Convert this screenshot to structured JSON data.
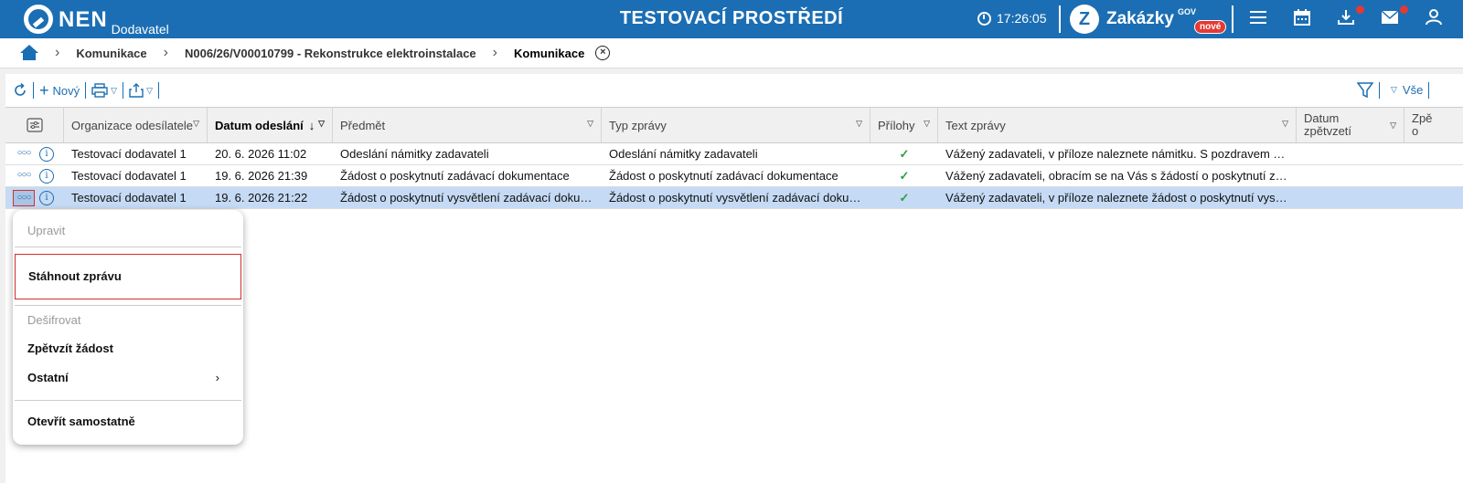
{
  "header": {
    "logo_text": "NEN",
    "logo_sub": "Dodavatel",
    "environment_title": "TESTOVACÍ PROSTŘEDÍ",
    "time": "17:26:05",
    "zakazky_logo": "Z",
    "zakazky_label": "Zakázky",
    "zakazky_gov": "GOV",
    "zakazky_badge": "nové",
    "icons": [
      "menu-icon",
      "calendar-icon",
      "download-icon",
      "mail-icon",
      "user-icon"
    ],
    "accent_color": "#1b6eb3",
    "notify_color": "#e53935"
  },
  "breadcrumb": {
    "items": [
      "Komunikace",
      "N006/26/V00010799 - Rekonstrukce elektroinstalace",
      "Komunikace"
    ]
  },
  "toolbar": {
    "new_label": "Nový",
    "all_label": "Vše"
  },
  "table": {
    "columns": [
      {
        "label": "Organizace odesílatele"
      },
      {
        "label": "Datum odeslání",
        "sorted": "desc"
      },
      {
        "label": "Předmět"
      },
      {
        "label": "Typ zprávy"
      },
      {
        "label": "Přílohy"
      },
      {
        "label": "Text zprávy"
      },
      {
        "label1": "Datum",
        "label2": "zpětvzetí"
      },
      {
        "label1": "Zpě",
        "label2": "o"
      }
    ],
    "rows": [
      {
        "org": "Testovací dodavatel 1",
        "date": "20. 6. 2026 11:02",
        "subject": "Odeslání námitky zadavateli",
        "type": "Odeslání námitky zadavateli",
        "attachment": "✓",
        "text": "Vážený zadavateli, v příloze naleznete námitku. S pozdravem Tes…",
        "selected": false
      },
      {
        "org": "Testovací dodavatel 1",
        "date": "19. 6. 2026 21:39",
        "subject": "Žádost o poskytnutí zadávací dokumentace",
        "type": "Žádost o poskytnutí zadávací dokumentace",
        "attachment": "✓",
        "text": "Vážený zadavateli, obracím se na Vás s žádostí o poskytnutí zad…",
        "selected": false
      },
      {
        "org": "Testovací dodavatel 1",
        "date": "19. 6. 2026 21:22",
        "subject": "Žádost o poskytnutí vysvětlení zadávací dokum…",
        "type": "Žádost o poskytnutí vysvětlení zadávací dokum…",
        "attachment": "✓",
        "text": "Vážený zadavateli, v příloze naleznete žádost o poskytnutí vysvět…",
        "selected": true
      }
    ]
  },
  "context_menu": {
    "items": [
      {
        "label": "Upravit",
        "disabled": true
      },
      {
        "label": "Stáhnout zprávu",
        "highlighted": true
      },
      {
        "label": "Dešifrovat",
        "disabled": true
      },
      {
        "label": "Zpětvzít žádost"
      },
      {
        "label": "Ostatní",
        "submenu": true
      },
      {
        "label": "Otevřít samostatně"
      }
    ],
    "highlight_color": "#d32f2f"
  }
}
